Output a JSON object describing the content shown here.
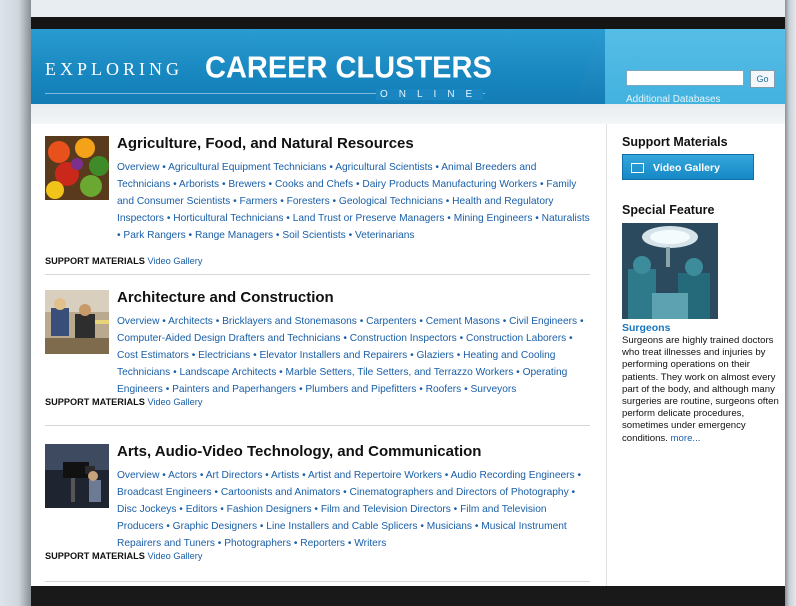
{
  "header": {
    "brand_exploring": "EXPLORING",
    "brand_career": "CAREER CLUSTERS",
    "brand_online": "ONLINE",
    "search": {
      "value": "",
      "go_label": "Go"
    },
    "additional_databases": "Additional Databases"
  },
  "clusters": [
    {
      "title": "Agriculture, Food, and Natural Resources",
      "links": [
        "Overview",
        "Agricultural Equipment Technicians",
        "Agricultural Scientists",
        "Animal Breeders and Technicians",
        "Arborists",
        "Brewers",
        "Cooks and Chefs",
        "Dairy Products Manufacturing Workers",
        "Family and Consumer Scientists",
        "Farmers",
        "Foresters",
        "Geological Technicians",
        "Health and Regulatory Inspectors",
        "Horticultural Technicians",
        "Land Trust or Preserve Managers",
        "Mining Engineers",
        "Naturalists",
        "Park Rangers",
        "Range Managers",
        "Soil Scientists",
        "Veterinarians"
      ],
      "support_label": "SUPPORT MATERIALS",
      "support_link": "Video Gallery",
      "thumb_icon": "vegetables-photo"
    },
    {
      "title": "Architecture and Construction",
      "links": [
        "Overview",
        "Architects",
        "Bricklayers and Stonemasons",
        "Carpenters",
        "Cement Masons",
        "Civil Engineers",
        "Computer-Aided Design Drafters and Technicians",
        "Construction Inspectors",
        "Construction Laborers",
        "Cost Estimators",
        "Electricians",
        "Elevator Installers and Repairers",
        "Glaziers",
        "Heating and Cooling Technicians",
        "Landscape Architects",
        "Marble Setters, Tile Setters, and Terrazzo Workers",
        "Operating Engineers",
        "Painters and Paperhangers",
        "Plumbers and Pipefitters",
        "Roofers",
        "Surveyors"
      ],
      "support_label": "SUPPORT MATERIALS",
      "support_link": "Video Gallery",
      "thumb_icon": "construction-workers-photo"
    },
    {
      "title": "Arts, Audio-Video Technology, and Communication",
      "links": [
        "Overview",
        "Actors",
        "Art Directors",
        "Artists",
        "Artist and Repertoire Workers",
        "Audio Recording Engineers",
        "Broadcast Engineers",
        "Cartoonists and Animators",
        "Cinematographers and Directors of Photography",
        "Disc Jockeys",
        "Editors",
        "Fashion Designers",
        "Film and Television Directors",
        "Film and Television Producers",
        "Graphic Designers",
        "Line Installers and Cable Splicers",
        "Musicians",
        "Musical Instrument Repairers and Tuners",
        "Photographers",
        "Reporters",
        "Writers"
      ],
      "support_label": "SUPPORT MATERIALS",
      "support_link": "Video Gallery",
      "thumb_icon": "tv-camera-studio-photo"
    }
  ],
  "sidebar": {
    "support_heading": "Support Materials",
    "video_gallery_button": "Video Gallery",
    "special_feature_heading": "Special Feature",
    "feature_image_icon": "surgeons-operating-photo",
    "feature_title": "Surgeons",
    "feature_body": "Surgeons are highly trained doctors who treat illnesses and injuries by performing operations on their patients. They work on almost every part of the body, and although many surgeries are routine, surgeons often perform delicate procedures, sometimes under emergency conditions.",
    "more_link": "more..."
  },
  "colors": {
    "banner_blue": "#1786bf",
    "link_blue": "#1a5fa8",
    "feature_title_blue": "#1a75bd"
  }
}
